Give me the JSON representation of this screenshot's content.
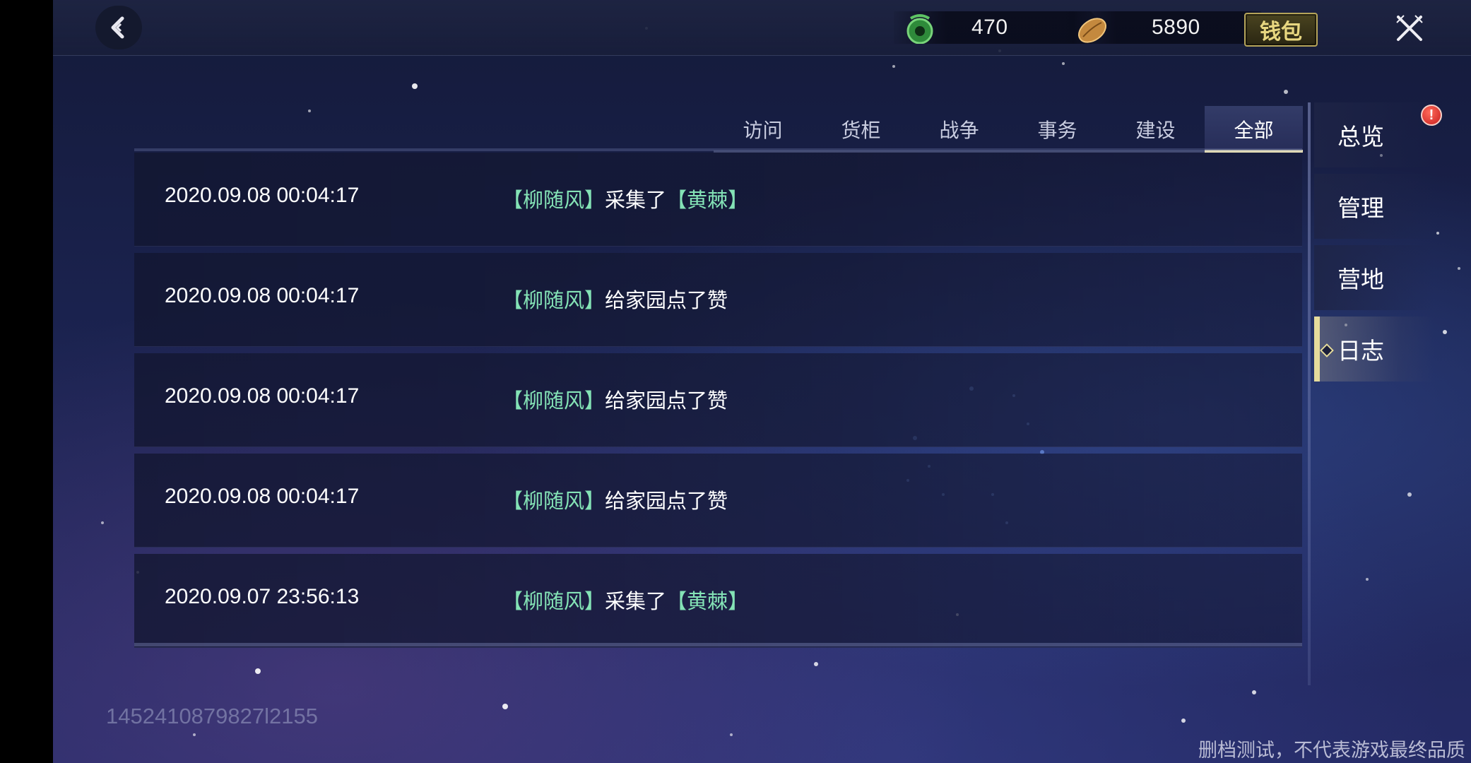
{
  "topbar": {
    "currency_jade": "470",
    "currency_seed": "5890",
    "wallet_label": "钱包"
  },
  "tabs": [
    {
      "label": "访问",
      "active": false
    },
    {
      "label": "货柜",
      "active": false
    },
    {
      "label": "战争",
      "active": false
    },
    {
      "label": "事务",
      "active": false
    },
    {
      "label": "建设",
      "active": false
    },
    {
      "label": "全部",
      "active": true
    }
  ],
  "logs": [
    {
      "time": "2020.09.08 00:04:17",
      "player": "柳随风",
      "action": "采集了",
      "item": "黄棘"
    },
    {
      "time": "2020.09.08 00:04:17",
      "player": "柳随风",
      "action": "给家园点了赞",
      "item": ""
    },
    {
      "time": "2020.09.08 00:04:17",
      "player": "柳随风",
      "action": "给家园点了赞",
      "item": ""
    },
    {
      "time": "2020.09.08 00:04:17",
      "player": "柳随风",
      "action": "给家园点了赞",
      "item": ""
    },
    {
      "time": "2020.09.07 23:56:13",
      "player": "柳随风",
      "action": "采集了",
      "item": "黄棘"
    }
  ],
  "side_menu": [
    {
      "label": "总览",
      "active": false,
      "badge": "!"
    },
    {
      "label": "管理",
      "active": false
    },
    {
      "label": "营地",
      "active": false
    },
    {
      "label": "日志",
      "active": true
    }
  ],
  "footer": {
    "id_text": "1452410879827l2155",
    "disclaimer": "删档测试，不代表游戏最终品质"
  },
  "colors": {
    "highlight_text": "#84e3b6",
    "active_accent": "#e6dc9c",
    "badge_red": "#c81e1e"
  }
}
